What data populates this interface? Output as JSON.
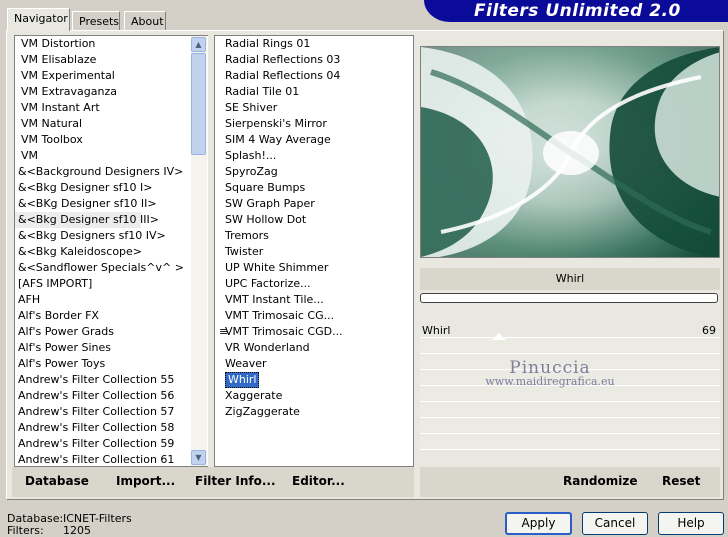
{
  "app": {
    "title": "Filters Unlimited 2.0"
  },
  "tabs": [
    {
      "label": "Navigator"
    },
    {
      "label": "Presets"
    },
    {
      "label": "About"
    }
  ],
  "categories": [
    "VM Distortion",
    "VM Elisablaze",
    "VM Experimental",
    "VM Extravaganza",
    "VM Instant Art",
    "VM Natural",
    "VM Toolbox",
    "VM",
    "&<Background Designers IV>",
    "&<Bkg Designer sf10 I>",
    "&<BKg Designer sf10 II>",
    "&<Bkg Designer sf10 III>",
    "&<Bkg Designers sf10 IV>",
    "&<Bkg Kaleidoscope>",
    "&<Sandflower Specials^v^ >",
    "[AFS IMPORT]",
    "AFH",
    "Alf's Border FX",
    "Alf's Power Grads",
    "Alf's Power Sines",
    "Alf's Power Toys",
    "Andrew's Filter Collection 55",
    "Andrew's Filter Collection 56",
    "Andrew's Filter Collection 57",
    "Andrew's Filter Collection 58",
    "Andrew's Filter Collection 59",
    "Andrew's Filter Collection 61"
  ],
  "filters": [
    "Radial  Rings 01",
    "Radial Reflections 03",
    "Radial Reflections 04",
    "Radial Tile 01",
    "SE Shiver",
    "Sierpenski's Mirror",
    "SIM 4 Way Average",
    "Splash!...",
    "SpyroZag",
    "Square Bumps",
    "SW Graph Paper",
    "SW Hollow Dot",
    "Tremors",
    "Twister",
    "UP White Shimmer",
    "UPC Factorize...",
    "VMT Instant Tile...",
    "VMT Trimosaic CG...",
    "VMT Trimosaic CGD...",
    "VR Wonderland",
    "Weaver",
    "Whirl",
    "Xaggerate",
    "ZigZaggerate"
  ],
  "preview": {
    "filter_name": "Whirl"
  },
  "params": [
    {
      "label": "Whirl",
      "value": "69"
    },
    {
      "label": "",
      "value": ""
    },
    {
      "label": "",
      "value": ""
    },
    {
      "label": "",
      "value": ""
    },
    {
      "label": "",
      "value": ""
    },
    {
      "label": "",
      "value": ""
    },
    {
      "label": "",
      "value": ""
    },
    {
      "label": "",
      "value": ""
    }
  ],
  "watermark": {
    "line1": "Pinuccia",
    "line2": "www.maidiregrafica.eu"
  },
  "toolbar": {
    "database": "Database",
    "import": "Import...",
    "filter_info": "Filter Info...",
    "editor": "Editor...",
    "randomize": "Randomize",
    "reset": "Reset"
  },
  "footer": {
    "database_label": "Database:",
    "database_value": "ICNET-Filters",
    "filters_label": "Filters:",
    "filters_value": "1205",
    "apply": "Apply",
    "cancel": "Cancel",
    "help": "Help"
  }
}
